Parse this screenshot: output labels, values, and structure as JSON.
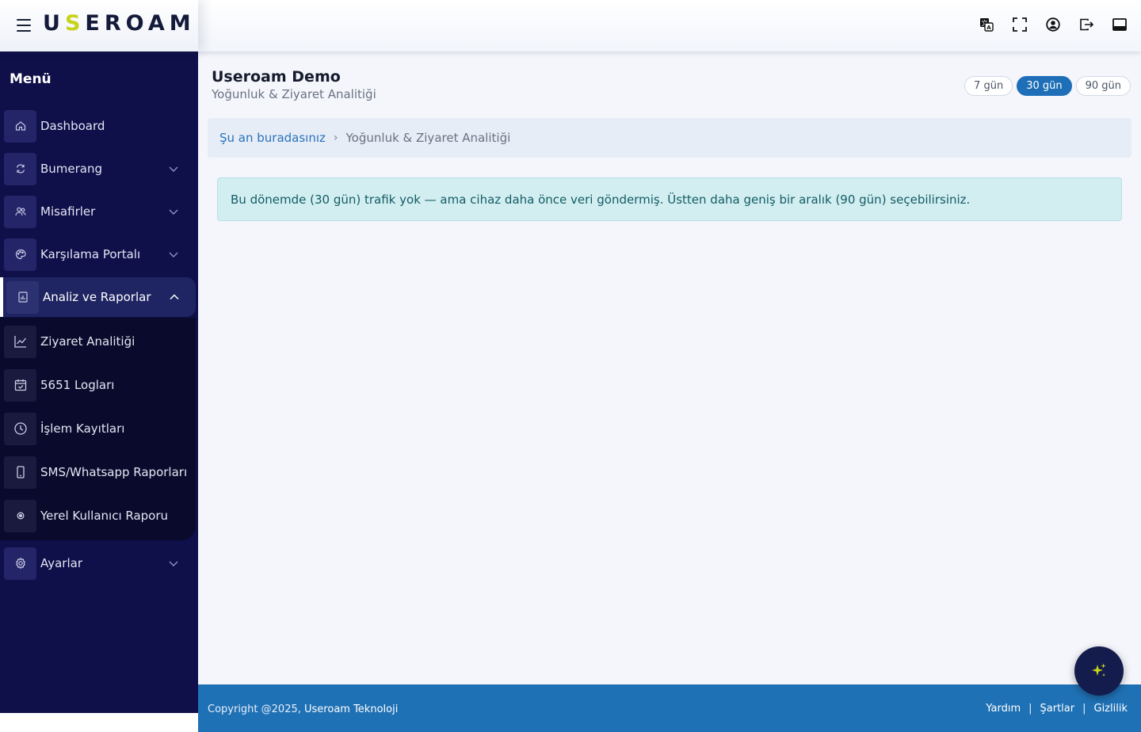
{
  "brand": {
    "logo_text": "USEROAM",
    "accent_color": "#c6d317"
  },
  "topbar": {
    "icons": [
      "translate-icon",
      "fullscreen-icon",
      "user-circle-icon",
      "logout-icon",
      "layout-icon"
    ]
  },
  "sidebar": {
    "title": "Menü",
    "items": [
      {
        "label": "Dashboard",
        "icon": "home-icon"
      },
      {
        "label": "Bumerang",
        "icon": "refresh-icon"
      },
      {
        "label": "Misafirler",
        "icon": "users-icon"
      },
      {
        "label": "Karşılama Portalı",
        "icon": "palette-icon"
      },
      {
        "label": "Analiz ve Raporlar",
        "icon": "report-icon"
      },
      {
        "label": "Ayarlar",
        "icon": "gear-icon"
      }
    ],
    "submenu": [
      {
        "label": "Ziyaret Analitiği",
        "icon": "chart-line-icon"
      },
      {
        "label": "5651 Logları",
        "icon": "calendar-check-icon"
      },
      {
        "label": "İşlem Kayıtları",
        "icon": "clock-icon"
      },
      {
        "label": "SMS/Whatsapp Raporları",
        "icon": "phone-icon"
      },
      {
        "label": "Yerel Kullanıcı Raporu",
        "icon": "target-icon"
      }
    ]
  },
  "page": {
    "title": "Useroam Demo",
    "subtitle": "Yoğunluk & Ziyaret Analitiği",
    "ranges": [
      "7 gün",
      "30 gün",
      "90 gün"
    ],
    "selected_range": "30 gün"
  },
  "breadcrumb": {
    "link": "Şu an buradasınız",
    "current": "Yoğunluk & Ziyaret Analitiği"
  },
  "alert": {
    "text": "Bu dönemde (30 gün) trafik yok — ama cihaz daha önce veri göndermiş. Üstten daha geniş bir aralık (90 gün) seçebilirsiniz."
  },
  "footer": {
    "copyright": "Copyright @2025,",
    "company": "Useroam Teknoloji",
    "links": [
      "Yardım",
      "Şartlar",
      "Gizlilik"
    ]
  }
}
